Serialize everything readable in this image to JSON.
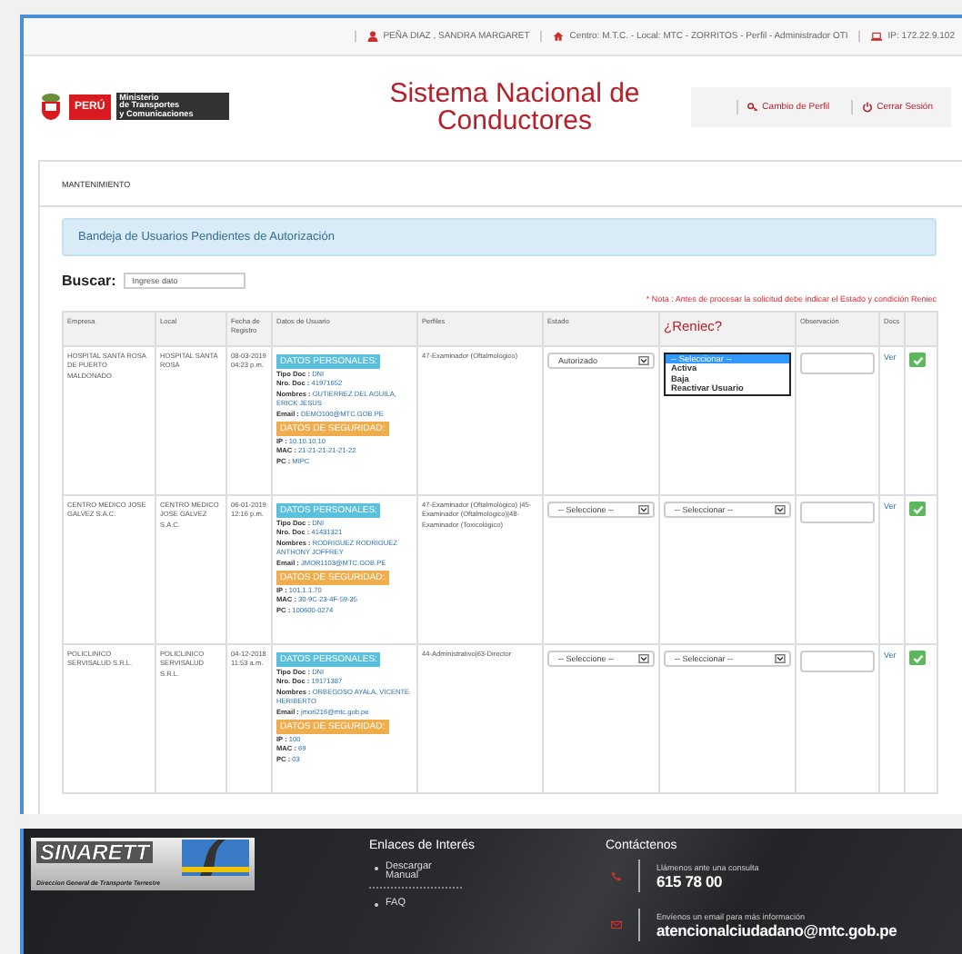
{
  "top_bar": {
    "user": "PEÑA DIAZ , SANDRA MARGARET",
    "centro": "Centro: M.T.C. - Local: MTC - ZORRITOS - Perfil - Administrador OTI",
    "ip": "IP: 172.22.9.102"
  },
  "header": {
    "logo": {
      "country": "PERÚ",
      "ministry": [
        "Ministerio",
        "de Transportes",
        "y Comunicaciones"
      ]
    },
    "title": "Sistema Nacional de Conductores",
    "actions": [
      "Cambio de Perfil",
      "Cerrar Sesión"
    ]
  },
  "breadcrumb": "MANTENIMIENTO",
  "panel_title": "Bandeja de Usuarios Pendientes de Autorización",
  "search": {
    "label": "Buscar:",
    "placeholder": "Ingrese dato"
  },
  "note": "* Nota : Antes de procesar la solicitud debe indicar el Estado y condición Reniec",
  "table": {
    "columns": [
      {
        "label": "Empresa",
        "highlighted": false
      },
      {
        "label": "Local",
        "highlighted": false
      },
      {
        "label": "Fecha de Registro",
        "highlighted": false
      },
      {
        "label": "Datos de Usuario",
        "highlighted": false
      },
      {
        "label": "Perfiles",
        "highlighted": false
      },
      {
        "label": "Estado",
        "highlighted": false
      },
      {
        "label": "¿Reniec?",
        "highlighted": true
      },
      {
        "label": "Observación",
        "highlighted": false
      },
      {
        "label": "Docs",
        "highlighted": false
      }
    ],
    "rows": [
      {
        "empresa": "HOSPITAL SANTA ROSA DE PUERTO MALDONADO",
        "local": "HOSPITAL SANTA ROSA",
        "fecha": "08-03-2019 04:23 p.m.",
        "personal_heading": "DATOS PERSONALES:",
        "personal": [
          {
            "label": "Tipo Doc :",
            "value": "DNI"
          },
          {
            "label": "Nro. Doc :",
            "value": "41971652"
          },
          {
            "label": "Nombres :",
            "value": "GUTIERREZ DEL AGUILA, ERICK JESUS"
          },
          {
            "label": "Email :",
            "value": "DEMO100@MTC.GOB.PE"
          }
        ],
        "security_heading": "DATOS DE SEGURIDAD:",
        "security": [
          {
            "label": "IP :",
            "value": "10.10.10.10"
          },
          {
            "label": "MAC :",
            "value": "21-21-21-21-21-22"
          },
          {
            "label": "PC :",
            "value": "MIPC"
          }
        ],
        "perfiles": "47-Examinador (Oftalmológico)",
        "estado": "Autorizado",
        "reniec": {
          "open": true,
          "options": [
            {
              "label": "-- Seleccionar --",
              "selected": true
            },
            {
              "label": "Activa",
              "selected": false
            },
            {
              "label": "Baja",
              "selected": false
            },
            {
              "label": "Reactivar Usuario",
              "selected": false
            }
          ]
        },
        "docs": "Ver"
      },
      {
        "empresa": "CENTRO MEDICO JOSE GALVEZ S.A.C.",
        "local": "CENTRO MEDICO JOSE GALVEZ S.A.C.",
        "fecha": "06-01-2019 12:16 p.m.",
        "personal_heading": "DATOS PERSONALES:",
        "personal": [
          {
            "label": "Tipo Doc :",
            "value": "DNI"
          },
          {
            "label": "Nro. Doc :",
            "value": "41431321"
          },
          {
            "label": "Nombres :",
            "value": "RODRIGUEZ RODRIGUEZ ANTHONY JOFFREY"
          },
          {
            "label": "Email :",
            "value": "JMOR1103@MTC.GOB.PE"
          }
        ],
        "security_heading": "DATOS DE SEGURIDAD:",
        "security": [
          {
            "label": "IP :",
            "value": "101.1.1.70"
          },
          {
            "label": "MAC :",
            "value": "30-9C-23-4F-59-35"
          },
          {
            "label": "PC :",
            "value": "100600-0274"
          }
        ],
        "perfiles": "47-Examinador (Oftalmológico) |45-Examinador (Oftalmológico)|48-Examinador (Toxicológico)",
        "estado": "-- Seleccione --",
        "reniec": {
          "open": false,
          "value": "-- Seleccionar --"
        },
        "docs": "Ver"
      },
      {
        "empresa": "POLICLINICO SERVISALUD S.R.L.",
        "local": "POLICLINICO SERVISALUD S.R.L.",
        "fecha": "04-12-2018 11:53 a.m.",
        "personal_heading": "DATOS PERSONALES:",
        "personal": [
          {
            "label": "Tipo Doc :",
            "value": "DNI"
          },
          {
            "label": "Nro. Doc :",
            "value": "19171387"
          },
          {
            "label": "Nombres :",
            "value": "ORBEGOSO AYALA, VICENTE HERIBERTO"
          },
          {
            "label": "Email :",
            "value": "jmori216@mtc.gob.pe"
          }
        ],
        "security_heading": "DATOS DE SEGURIDAD:",
        "security": [
          {
            "label": "IP :",
            "value": "100"
          },
          {
            "label": "MAC :",
            "value": "69"
          },
          {
            "label": "PC :",
            "value": "03"
          }
        ],
        "perfiles": "44-Administrativo|63-Director",
        "estado": "-- Seleccione --",
        "reniec": {
          "open": false,
          "value": "-- Seleccionar --"
        },
        "docs": "Ver"
      }
    ]
  },
  "footer": {
    "logo": {
      "name": "SINARETT",
      "subtitle": "Direccion General de Transporte Terrestre"
    },
    "links_title": "Enlaces de Interés",
    "links": [
      "Descargar Manual",
      "FAQ"
    ],
    "contact_title": "Contáctenos",
    "contacts": [
      {
        "kind": "phone",
        "label": "Llámenos ante una consulta",
        "value": "615 78 00"
      },
      {
        "kind": "email",
        "label": "Envíenos un email para más información",
        "value": "atencionalciudadano@mtc.gob.pe"
      }
    ]
  }
}
